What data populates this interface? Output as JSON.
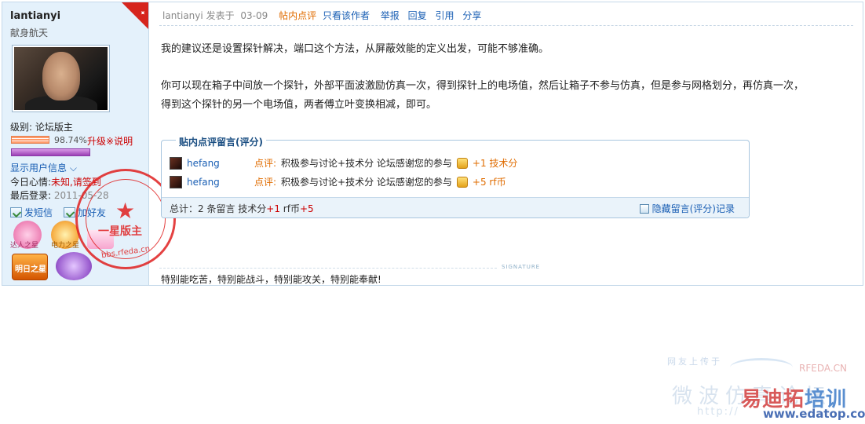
{
  "sidebar": {
    "username": "lantianyi",
    "user_title": "献身航天",
    "level_label": "级别: 论坛版主",
    "progress_percent": "98.74%",
    "upgrade": "升级",
    "upgrade_sep": "※",
    "explain": "说明",
    "show_user_info": "显示用户信息",
    "mood_label": "今日心情:",
    "mood_value": "未知,请签到",
    "last_login_label": "最后登录:",
    "last_login_value": "2011-05-28",
    "send_message": "发短信",
    "add_friend": "加好友",
    "badges": [
      {
        "name": "达人之星",
        "label": "达人之星"
      },
      {
        "name": "电力之星",
        "label": "电力之星"
      },
      {
        "name": "明日之星",
        "label": "明日之星"
      }
    ],
    "stamp": {
      "text": "一星版主",
      "url": "bbs.rfeda.cn"
    }
  },
  "post": {
    "author": "lantianyi",
    "posted_on": "发表于",
    "date": "03-09",
    "comment_link": "帖内点评",
    "only_author": "只看该作者",
    "report": "举报",
    "reply": "回复",
    "quote": "引用",
    "share": "分享",
    "paragraph1": "我的建议还是设置探针解决，端口这个方法，从屏蔽效能的定义出发，可能不够准确。",
    "paragraph2_line1": "你可以现在箱子中间放一个探针，外部平面波激励仿真一次，得到探针上的电场值，然后让箱子不参与仿真，但是参与网格划分，再仿真一次，",
    "paragraph2_line2": "得到这个探针的另一个电场值，两者傅立叶变换相减，即可。"
  },
  "rating": {
    "title": "贴内点评留言(评分)",
    "rows": [
      {
        "user": "hefang",
        "tag": "点评:",
        "comment": "积极参与讨论+技术分 论坛感谢您的参与",
        "score": "+1 技术分"
      },
      {
        "user": "hefang",
        "tag": "点评:",
        "comment": "积极参与讨论+技术分 论坛感谢您的参与",
        "score": "+5 rf币"
      }
    ],
    "total_prefix": "总计：2 条留言 技术分",
    "total_tech": "+1",
    "total_coin_label": " rf币",
    "total_coin": "+5",
    "hide": "隐藏留言(评分)记录"
  },
  "signature": {
    "label": "SIGNATURE",
    "text": "特别能吃苦，特别能战斗，特别能攻关，特别能奉献!"
  },
  "watermark": {
    "line1": "网友上传于",
    "site_en": "RFEDA.CN",
    "brand_cn": "微波仿真论坛",
    "training": "易迪拓",
    "training2": "培训",
    "url_http": "http://",
    "url": "www.edatop.com"
  },
  "colors": {
    "accent": "#1a5fb4",
    "orange": "#e06c00",
    "red": "#cc0000",
    "sidebar_bg": "#e4f1fb"
  }
}
